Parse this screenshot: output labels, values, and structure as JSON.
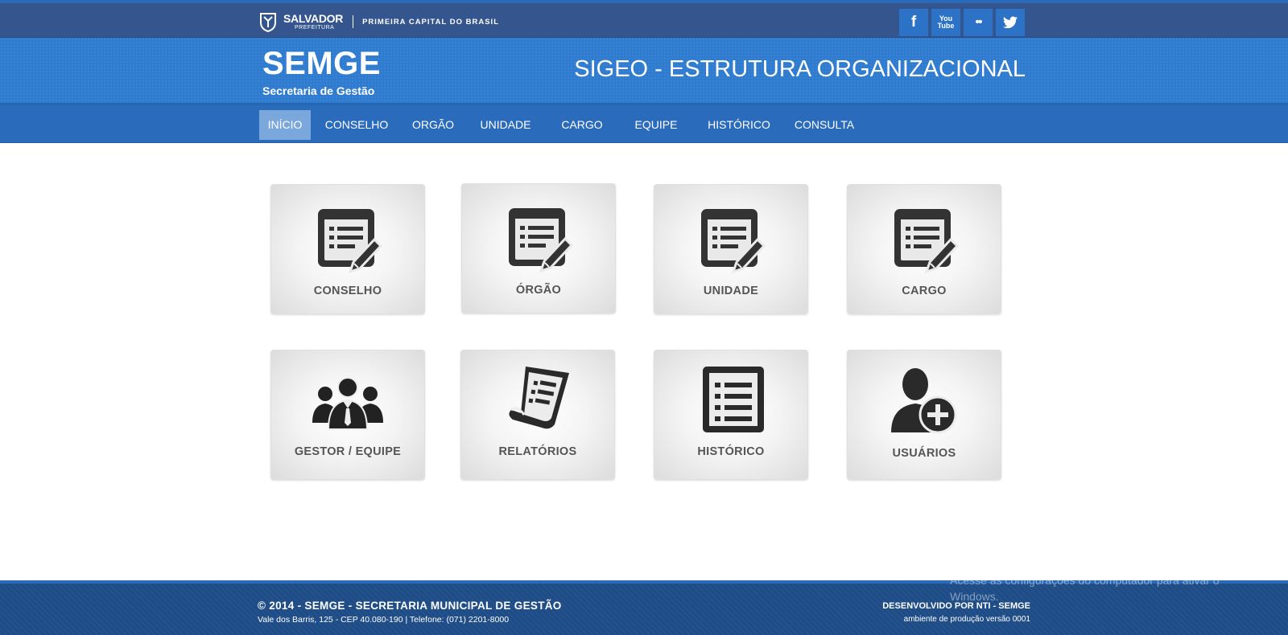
{
  "topbar": {
    "logo_name": "SALVADOR",
    "logo_sub": "PREFEITURA",
    "tagline": "PRIMEIRA CAPITAL DO BRASIL",
    "social": [
      {
        "icon": "facebook-icon",
        "label": "f"
      },
      {
        "icon": "youtube-icon",
        "label_top": "You",
        "label_bottom": "Tube"
      },
      {
        "icon": "flickr-icon",
        "label": "••"
      },
      {
        "icon": "twitter-icon",
        "label": ""
      }
    ]
  },
  "header": {
    "brand": "SEMGE",
    "brand_sub": "Secretaria de Gestão",
    "app_title": "SIGEO - ESTRUTURA ORGANIZACIONAL"
  },
  "nav": {
    "items": [
      "INÍCIO",
      "CONSELHO",
      "ORGÃO",
      "UNIDADE",
      "CARGO",
      "EQUIPE",
      "HISTÓRICO",
      "CONSULTA"
    ],
    "active": "INÍCIO"
  },
  "tiles": [
    {
      "label": "CONSELHO",
      "icon": "edit-list-icon"
    },
    {
      "label": "ÓRGÃO",
      "icon": "edit-list-icon"
    },
    {
      "label": "UNIDADE",
      "icon": "edit-list-icon"
    },
    {
      "label": "CARGO",
      "icon": "edit-list-icon"
    },
    {
      "label": "GESTOR / EQUIPE",
      "icon": "team-icon"
    },
    {
      "label": "RELATÓRIOS",
      "icon": "report-scroll-icon"
    },
    {
      "label": "HISTÓRICO",
      "icon": "list-icon"
    },
    {
      "label": "USUÁRIOS",
      "icon": "add-user-icon"
    }
  ],
  "footer": {
    "copyright": "© 2014 - SEMGE - SECRETARIA MUNICIPAL DE GESTÃO",
    "address": "Vale dos Barris, 125 - CEP 40.080-190 | Telefone: (071) 2201-8000",
    "developer": "DESENVOLVIDO POR NTI - SEMGE",
    "version": "ambiente de produção versão 0001"
  },
  "watermark": {
    "line1": "Acesse as configurações do computador para ativar o",
    "line2": "Windows."
  },
  "colors": {
    "topbar": "#34558d",
    "header": "#2f7bd0",
    "nav": "#2b6bbc",
    "nav_active": "#7aa7dc",
    "social_button": "#2c72c6",
    "footer": "#1d4c86",
    "tile_label": "#555555",
    "icon": "#333333"
  }
}
